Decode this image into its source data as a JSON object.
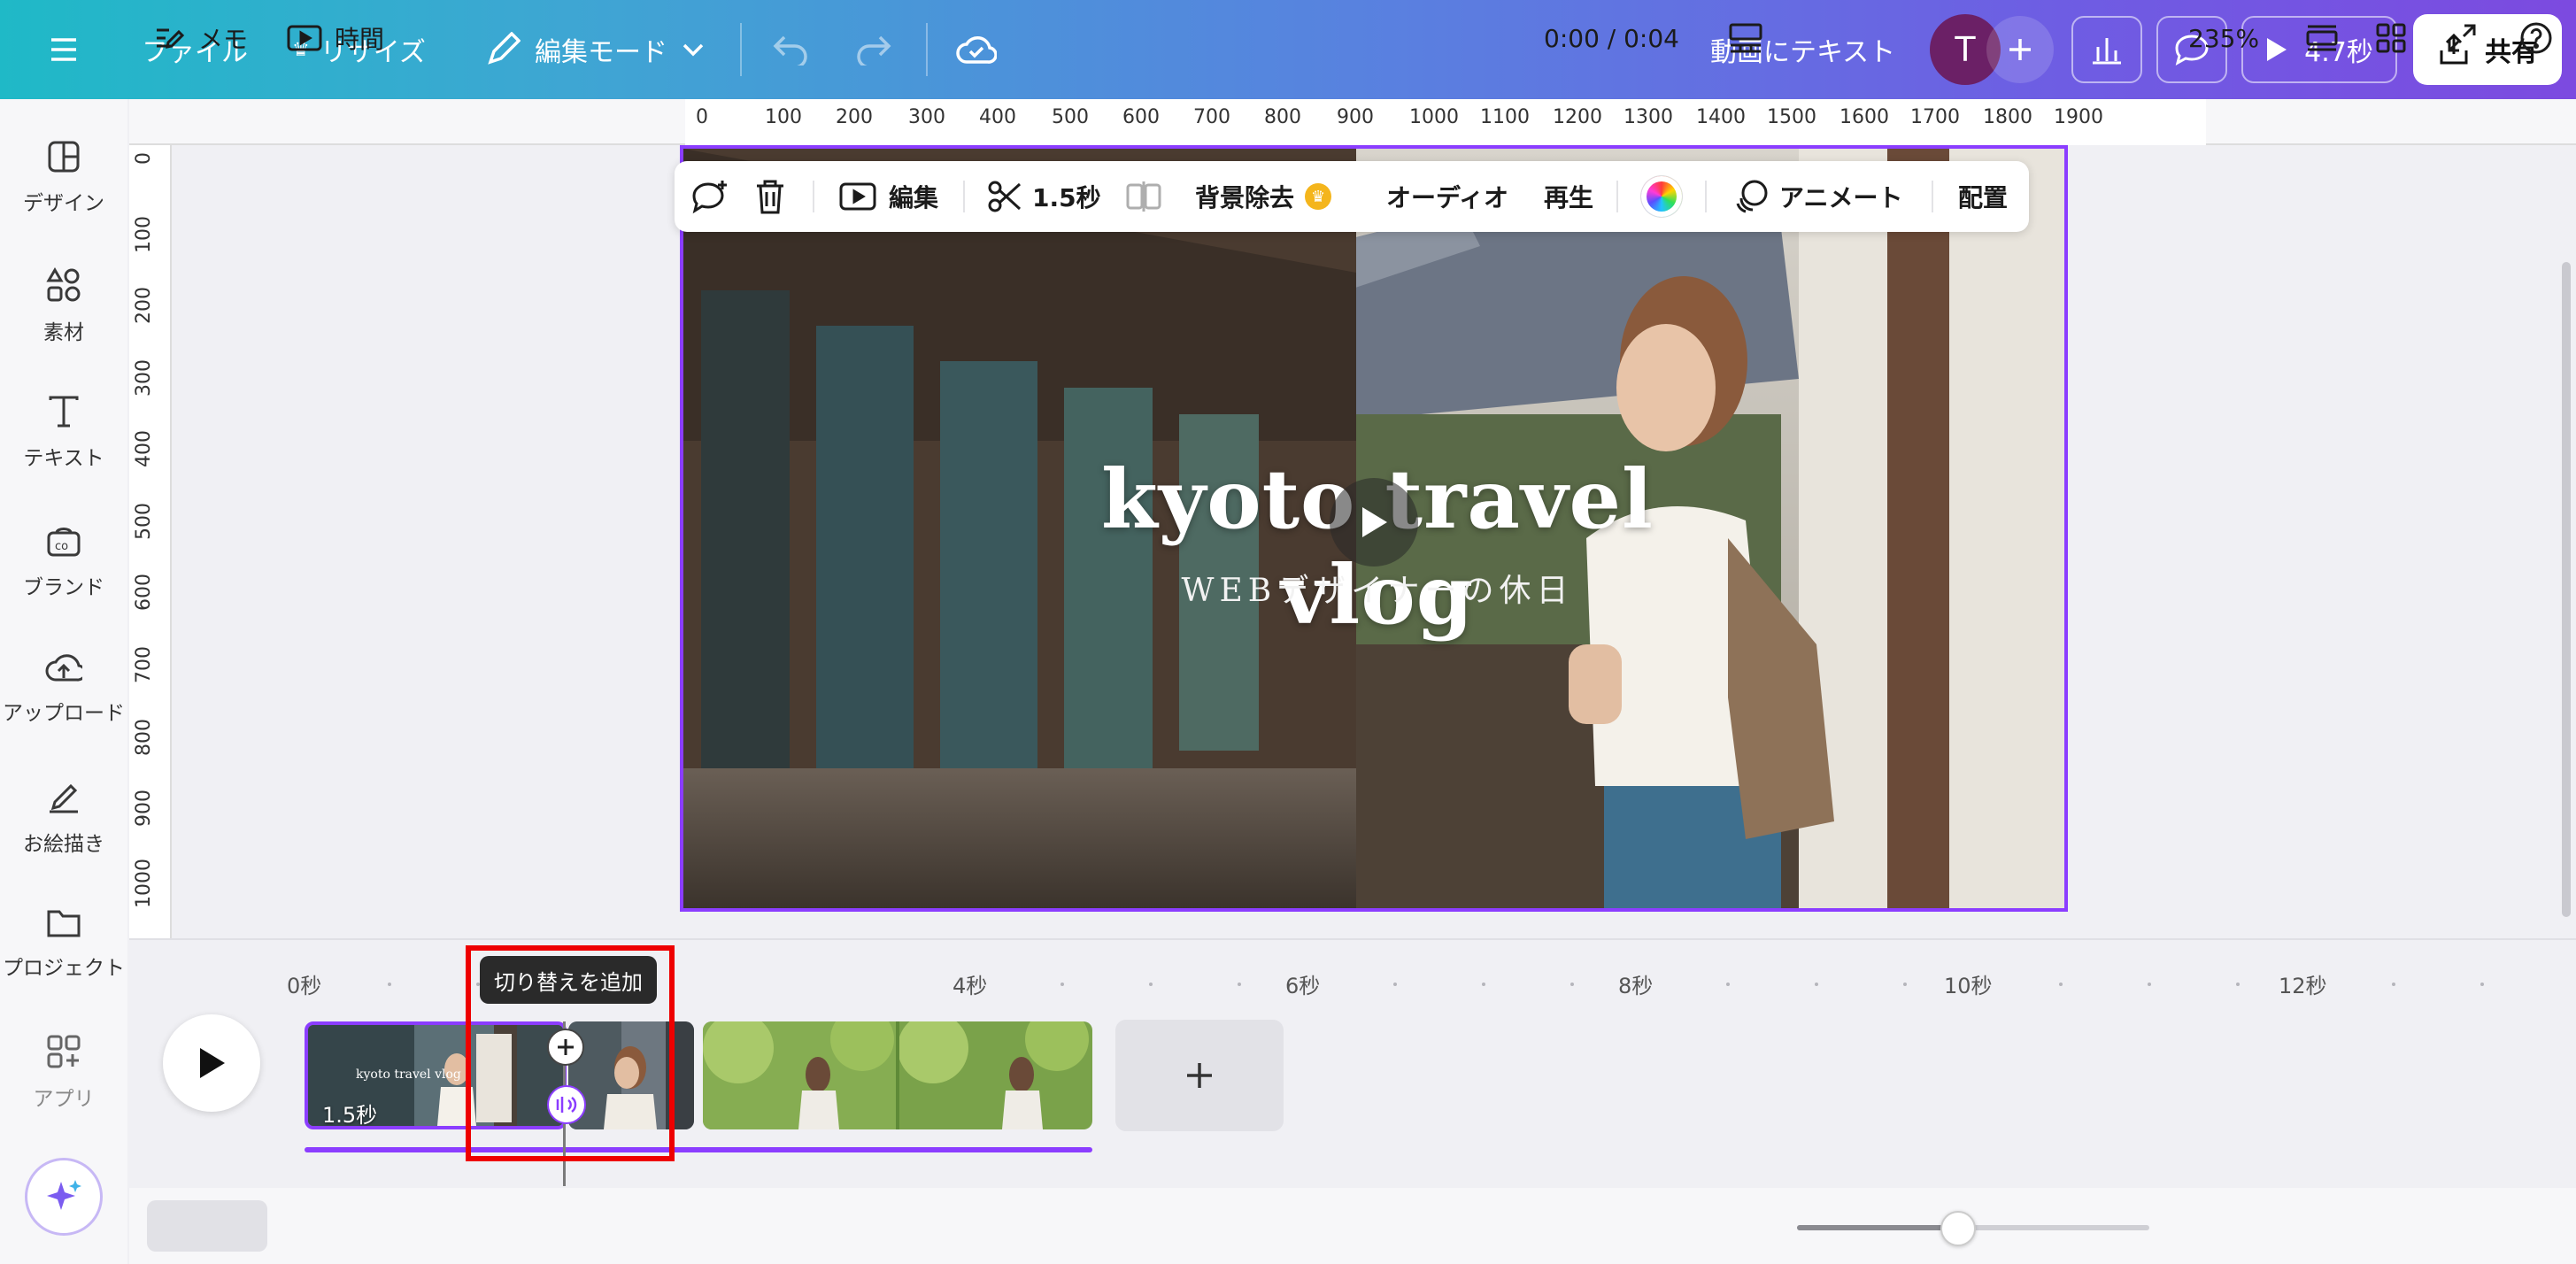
{
  "header": {
    "file_label": "ファイル",
    "resize_label": "リサイズ",
    "edit_mode_label": "編集モード",
    "design_title": "動画にテキスト",
    "avatar_initial": "T",
    "play_duration": "4.7秒",
    "share_label": "共有"
  },
  "sidebar": {
    "items": [
      {
        "label": "デザイン",
        "icon": "design-icon"
      },
      {
        "label": "素材",
        "icon": "elements-icon"
      },
      {
        "label": "テキスト",
        "icon": "text-icon"
      },
      {
        "label": "ブランド",
        "icon": "brand-icon"
      },
      {
        "label": "アップロード",
        "icon": "upload-icon"
      },
      {
        "label": "お絵描き",
        "icon": "draw-icon"
      },
      {
        "label": "プロジェクト",
        "icon": "folder-icon"
      },
      {
        "label": "アプリ",
        "icon": "apps-icon"
      }
    ]
  },
  "ruler": {
    "horizontal": [
      "0",
      "100",
      "200",
      "300",
      "400",
      "500",
      "600",
      "700",
      "800",
      "900",
      "1000",
      "1100",
      "1200",
      "1300",
      "1400",
      "1500",
      "1600",
      "1700",
      "1800",
      "1900"
    ],
    "vertical": [
      "0",
      "100",
      "200",
      "300",
      "400",
      "500",
      "600",
      "700",
      "800",
      "900",
      "1000"
    ]
  },
  "toolbar": {
    "edit_label": "編集",
    "duration_label": "1.5秒",
    "bg_remove_label": "背景除去",
    "audio_label": "オーディオ",
    "playback_label": "再生",
    "animate_label": "アニメート",
    "position_label": "配置"
  },
  "canvas": {
    "title": "kyoto travel vlog",
    "subtitle": "WEBデザイナーの休日"
  },
  "timeline": {
    "marks": [
      "0秒",
      "4秒",
      "6秒",
      "8秒",
      "10秒",
      "12秒"
    ],
    "clip1_duration": "1.5秒",
    "clip1_thumb_text": "kyoto travel vlog",
    "tooltip": "切り替えを追加"
  },
  "bottombar": {
    "notes_label": "メモ",
    "time_label": "時間",
    "timecode": "0:00 / 0:04",
    "zoom": "235%",
    "zoom_fraction": 0.46
  }
}
